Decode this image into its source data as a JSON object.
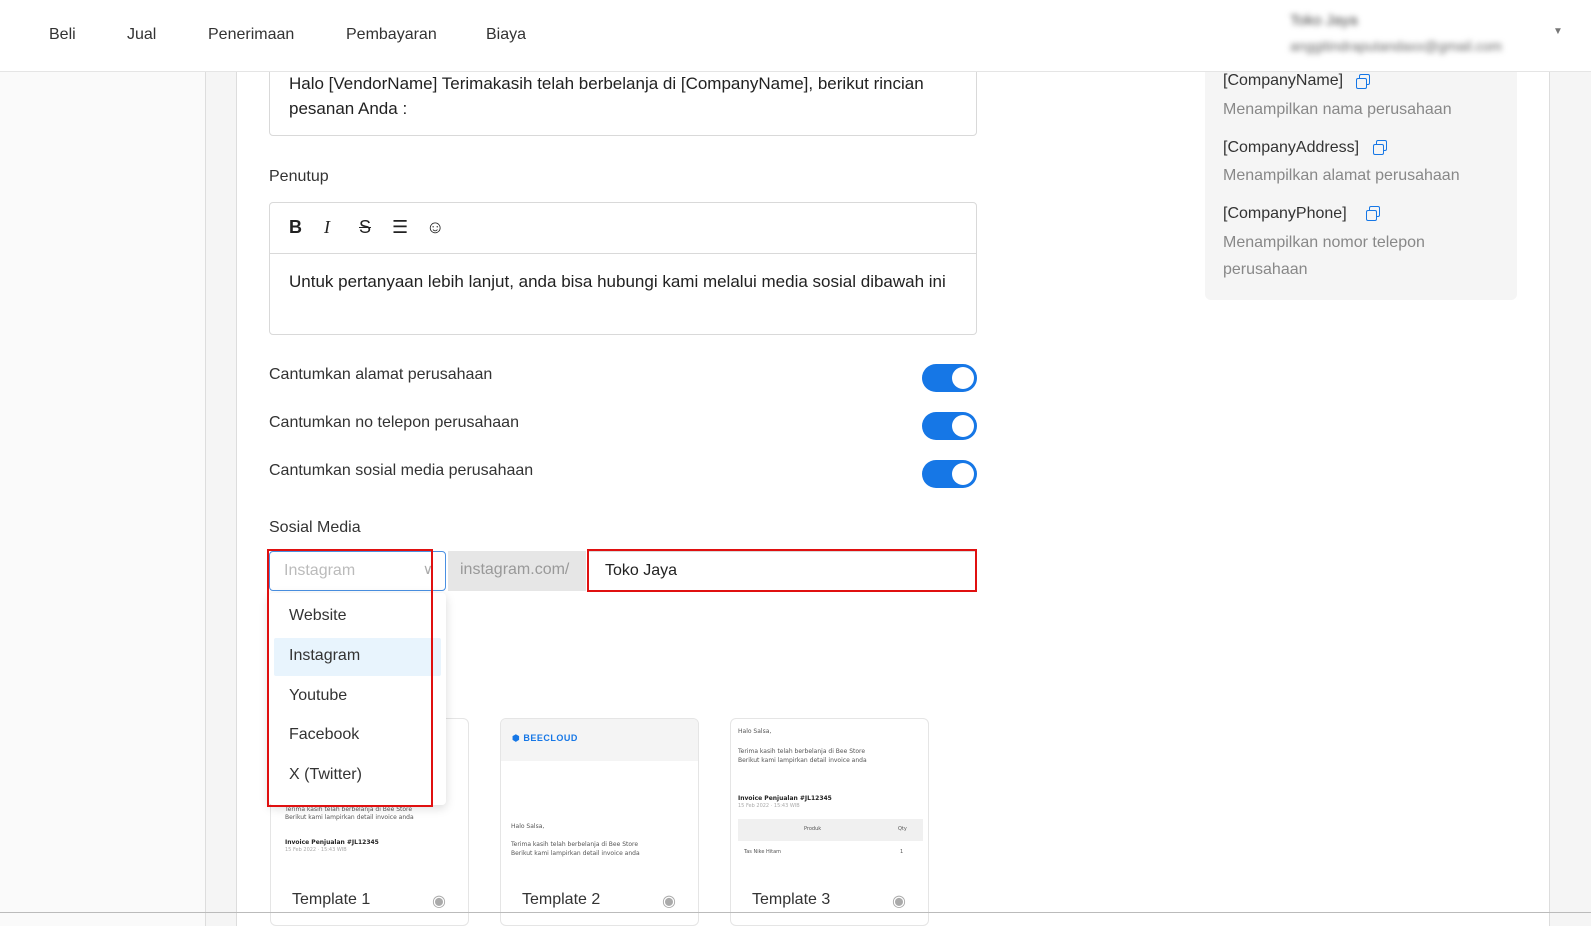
{
  "nav": {
    "items": [
      "Beli",
      "Jual",
      "Penerimaan",
      "Pembayaran",
      "Biaya"
    ],
    "user_name": "Toko Jaya",
    "user_email": "anggitindraputandaxx@gmail.com"
  },
  "opening": {
    "text": "Halo [VendorName] Terimakasih telah berbelanja di [CompanyName], berikut rincian pesanan Anda :"
  },
  "closing": {
    "label": "Penutup",
    "toolbar_icons": [
      "bold-icon",
      "italic-icon",
      "strikethrough-icon",
      "align-icon",
      "emoji-icon"
    ],
    "toolbar_glyphs": [
      "B",
      "I",
      "S",
      "☰",
      "☺"
    ],
    "text": "Untuk pertanyaan lebih lanjut, anda bisa hubungi kami melalui media sosial dibawah ini"
  },
  "toggles": [
    {
      "label": "Cantumkan alamat perusahaan",
      "on": true
    },
    {
      "label": "Cantumkan no telepon perusahaan",
      "on": true
    },
    {
      "label": "Cantumkan sosial media perusahaan",
      "on": true
    }
  ],
  "social": {
    "label": "Sosial Media",
    "select_placeholder": "Instagram",
    "addon": "instagram.com/",
    "value": "Toko Jaya",
    "options": [
      "Website",
      "Instagram",
      "Youtube",
      "Facebook",
      "X (Twitter)"
    ],
    "active_option": "Instagram"
  },
  "templates": [
    {
      "name": "Template 1",
      "lines": [
        "Terima kasih telah berbelanja di Bee Store",
        "Berikut kami lampirkan detail invoice anda",
        "Invoice Penjualan #JL12345",
        "15 Feb 2022 · 15:43 WIB"
      ]
    },
    {
      "name": "Template 2",
      "brand": "BEECLOUD",
      "lines": [
        "Halo Salsa,",
        "Terima kasih telah berbelanja di Bee Store",
        "Berikut kami lampirkan detail invoice anda"
      ]
    },
    {
      "name": "Template 3",
      "lines": [
        "Halo Salsa,",
        "Terima kasih telah berbelanja di Bee Store",
        "Berikut kami lampirkan detail invoice anda",
        "Invoice Penjualan #JL12345",
        "15 Feb 2022 · 15:43 WIB"
      ],
      "table": {
        "headers": [
          "Produk",
          "Qty"
        ],
        "row": [
          "Tas Nike Hitam",
          "1"
        ]
      }
    }
  ],
  "placeholders": [
    {
      "key": "[CompanyName]",
      "desc": "Menampilkan nama perusahaan"
    },
    {
      "key": "[CompanyAddress]",
      "desc": "Menampilkan alamat perusahaan"
    },
    {
      "key": "[CompanyPhone]",
      "desc": "Menampilkan nomor telepon perusahaan"
    }
  ],
  "colors": {
    "accent": "#1677e6",
    "highlight": "#e01010",
    "active_option_bg": "#e8f4fd"
  }
}
